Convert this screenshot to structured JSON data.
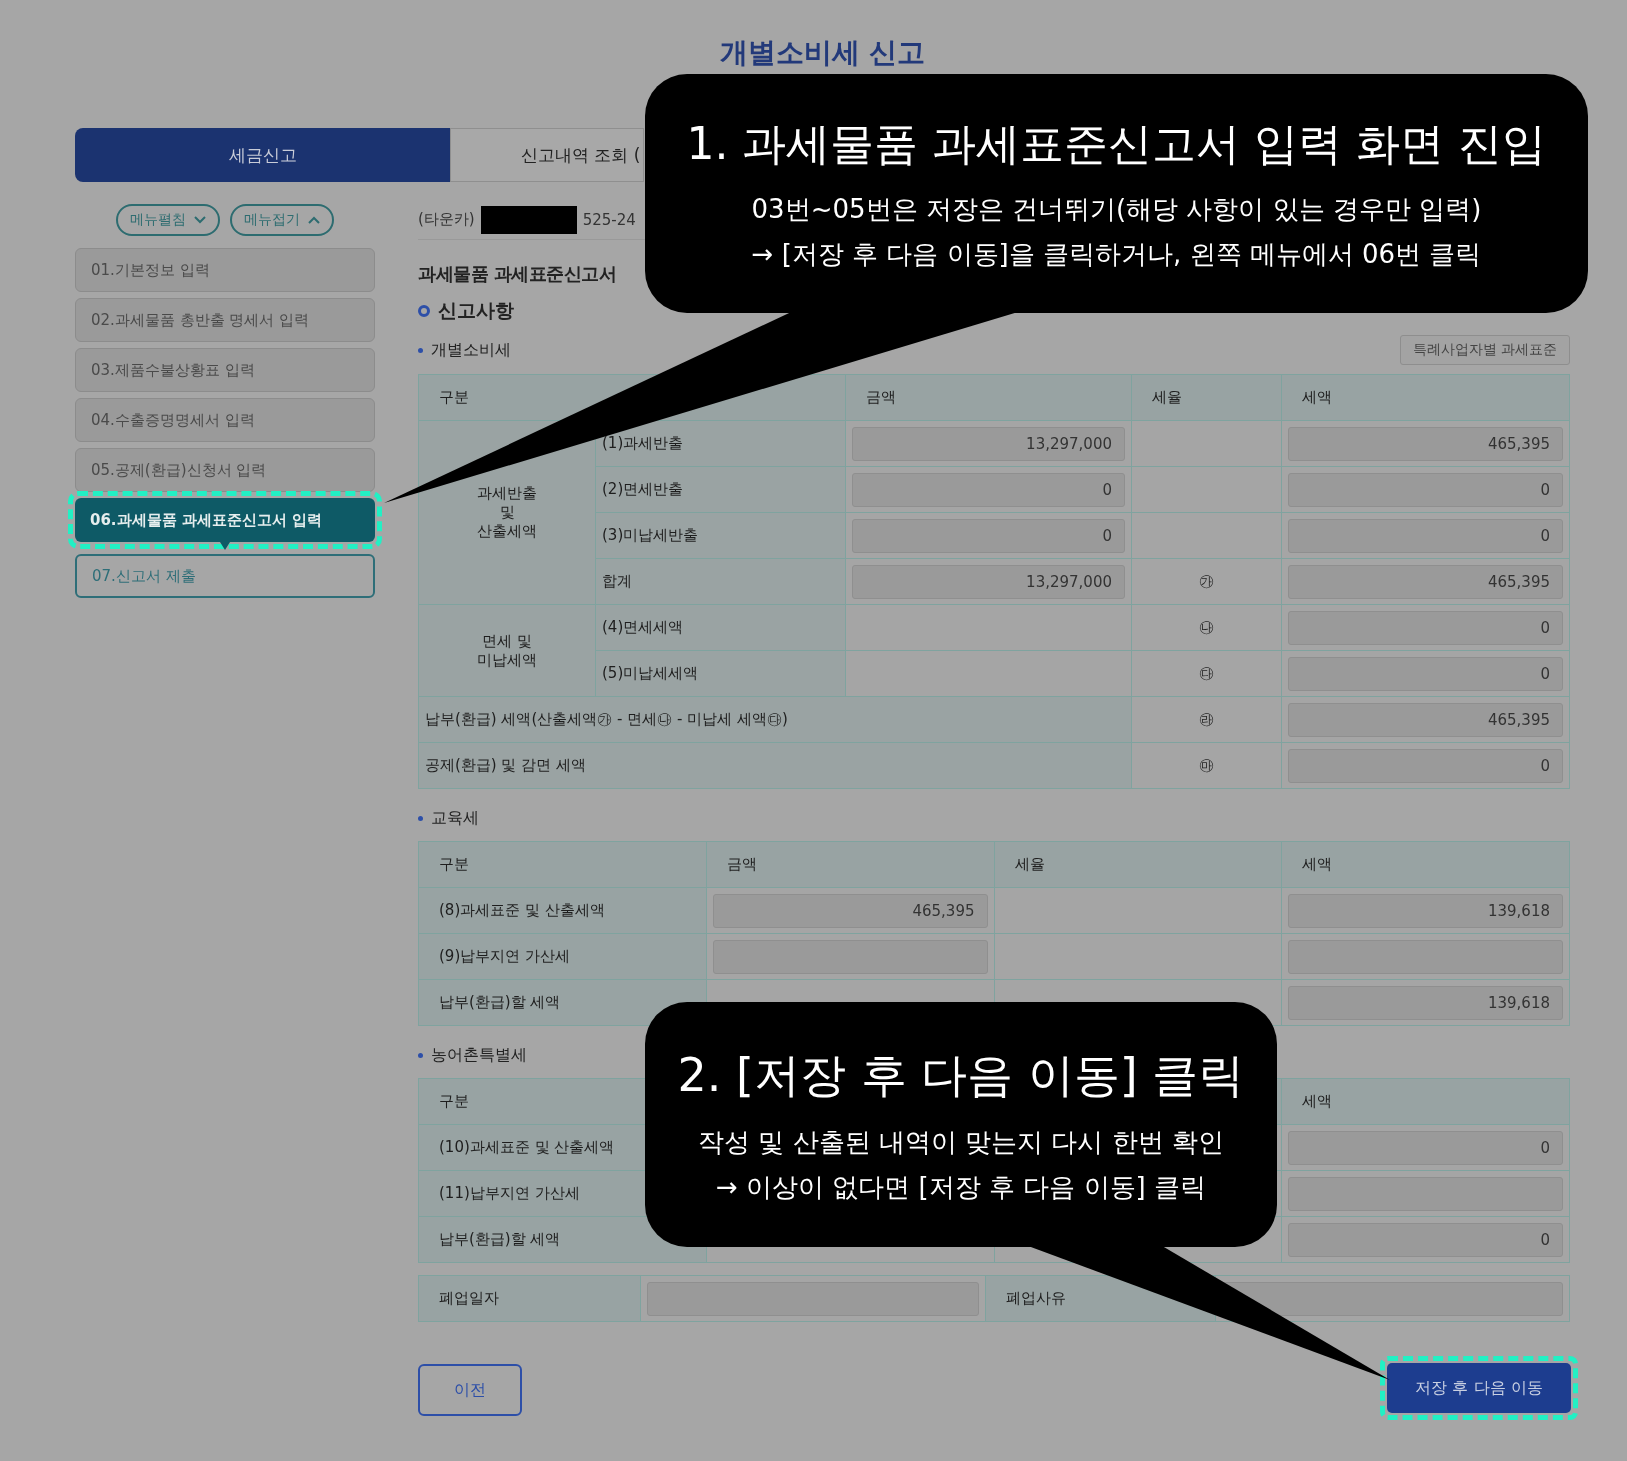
{
  "page_title": "개별소비세 신고",
  "tabs": [
    {
      "label": "세금신고",
      "selected": true
    },
    {
      "label": "신고내역 조회 (",
      "selected": false
    }
  ],
  "menu_buttons": [
    {
      "label": "메뉴펼침",
      "kind": "expand"
    },
    {
      "label": "메뉴접기",
      "kind": "collapse"
    }
  ],
  "steps": [
    {
      "label": "01.기본정보 입력",
      "selected": false,
      "done": true
    },
    {
      "label": "02.과세물품 총반출 명세서 입력",
      "selected": false,
      "done": true
    },
    {
      "label": "03.제품수불상황표 입력",
      "selected": false,
      "done": true
    },
    {
      "label": "04.수출증명명세서 입력",
      "selected": false,
      "done": true
    },
    {
      "label": "05.공제(환급)신청서 입력",
      "selected": false,
      "done": true
    },
    {
      "label": "06.과세물품 과세표준신고서 입력",
      "selected": true,
      "done": false
    },
    {
      "label": "07.신고서 제출",
      "selected": false,
      "done": false
    }
  ],
  "taxpayer": {
    "prefix": "(타운카)",
    "number": "525-24"
  },
  "form_title": "과세물품 과세표준신고서",
  "section_title": "신고사항",
  "excise": {
    "title": "개별소비세",
    "side_button": "특례사업자별 과세표준",
    "columns": [
      "구분",
      "금액",
      "세율",
      "세액"
    ],
    "groups": [
      {
        "label": "과세반출\n및\n산출세액",
        "rows": [
          {
            "label": "(1)과세반출",
            "kind": "input",
            "amount": "13,297,000",
            "tax": "465,395"
          },
          {
            "label": "(2)면세반출",
            "kind": "input",
            "amount": "0",
            "tax": "0"
          },
          {
            "label": "(3)미납세반출",
            "kind": "input",
            "amount": "0",
            "tax": "0"
          },
          {
            "label": "합계",
            "kind": "input",
            "amount": "13,297,000",
            "rate_mark": "㉮",
            "tax": "465,395"
          }
        ]
      },
      {
        "label": "면세 및\n미납세액",
        "rows": [
          {
            "label": "(4)면세세액",
            "kind": "tax_only",
            "rate_mark": "㉯",
            "tax": "0"
          },
          {
            "label": "(5)미납세세액",
            "kind": "tax_only",
            "rate_mark": "㉰",
            "tax": "0"
          }
        ]
      }
    ],
    "totals": [
      {
        "label": "납부(환급) 세액(산출세액㉮ - 면세㉯ - 미납세 세액㉰)",
        "rate_mark": "㉱",
        "tax": "465,395"
      },
      {
        "label": "공제(환급) 및 감면 세액",
        "rate_mark": "㉲",
        "tax": "0"
      }
    ]
  },
  "education": {
    "title": "교육세",
    "columns": [
      "구분",
      "금액",
      "세율",
      "세액"
    ],
    "rows": [
      {
        "label": "(8)과세표준 및 산출세액",
        "kind": "input",
        "amount": "465,395",
        "tax": "139,618"
      },
      {
        "label": "(9)납부지연 가산세",
        "kind": "input"
      },
      {
        "label": "납부(환급)할 세액",
        "kind": "tax_only",
        "tax": "139,618"
      }
    ]
  },
  "rural": {
    "title": "농어촌특별세",
    "columns": [
      "구분",
      "세액"
    ],
    "rows": [
      {
        "label": "(10)과세표준 및 산출세액",
        "kind": "tax_only",
        "tax": "0"
      },
      {
        "label": "(11)납부지연 가산세",
        "kind": "tax_only"
      },
      {
        "label": "납부(환급)할 세액",
        "kind": "tax_only",
        "tax": "0"
      }
    ]
  },
  "closure": [
    {
      "label": "폐업일자"
    },
    {
      "label": "폐업사유"
    }
  ],
  "buttons": {
    "prev": {
      "label": "이전"
    },
    "next": {
      "label": "저장 후 다음 이동",
      "highlighted": true
    }
  },
  "callouts": [
    {
      "title": "1. 과세물품 과세표준신고서 입력 화면 진입",
      "lines": [
        "03번~05번은 저장은 건너뛰기(해당 사항이 있는 경우만 입력)",
        "→ [저장 후 다음 이동]을 클릭하거나, 왼쪽 메뉴에서 06번 클릭"
      ]
    },
    {
      "title": "2. [저장 후 다음 이동] 클릭",
      "lines": [
        "작성 및 산출된 내역이 맞는지 다시 한번 확인",
        "→ 이상이 없다면 [저장 후 다음 이동] 클릭"
      ]
    }
  ]
}
